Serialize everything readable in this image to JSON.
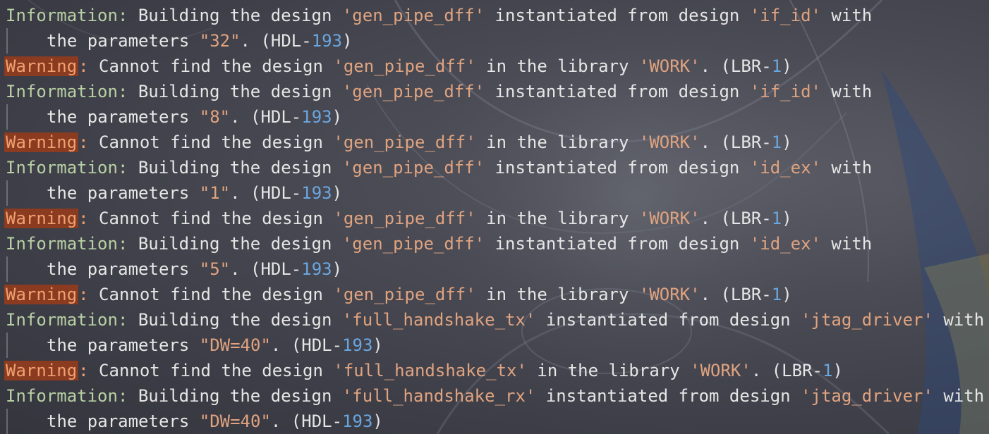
{
  "log": [
    {
      "kind": "info",
      "level": "Information",
      "segments": [
        {
          "t": "p",
          "v": " Building the design "
        },
        {
          "t": "s",
          "v": "'gen_pipe_dff'"
        },
        {
          "t": "p",
          "v": " instantiated from design "
        },
        {
          "t": "s",
          "v": "'if_id'"
        },
        {
          "t": "p",
          "v": " with"
        }
      ]
    },
    {
      "kind": "cont",
      "segments": [
        {
          "t": "p",
          "v": "the parameters "
        },
        {
          "t": "s",
          "v": "\"32\""
        },
        {
          "t": "p",
          "v": ". (HDL-"
        },
        {
          "t": "n",
          "v": "193"
        },
        {
          "t": "p",
          "v": ")"
        }
      ]
    },
    {
      "kind": "warn",
      "level": "Warning",
      "segments": [
        {
          "t": "p",
          "v": " Cannot find the design "
        },
        {
          "t": "s",
          "v": "'gen_pipe_dff'"
        },
        {
          "t": "p",
          "v": " in the library "
        },
        {
          "t": "s",
          "v": "'WORK'"
        },
        {
          "t": "p",
          "v": ". (LBR-"
        },
        {
          "t": "n",
          "v": "1"
        },
        {
          "t": "p",
          "v": ")"
        }
      ]
    },
    {
      "kind": "info",
      "level": "Information",
      "segments": [
        {
          "t": "p",
          "v": " Building the design "
        },
        {
          "t": "s",
          "v": "'gen_pipe_dff'"
        },
        {
          "t": "p",
          "v": " instantiated from design "
        },
        {
          "t": "s",
          "v": "'if_id'"
        },
        {
          "t": "p",
          "v": " with"
        }
      ]
    },
    {
      "kind": "cont",
      "segments": [
        {
          "t": "p",
          "v": "the parameters "
        },
        {
          "t": "s",
          "v": "\"8\""
        },
        {
          "t": "p",
          "v": ". (HDL-"
        },
        {
          "t": "n",
          "v": "193"
        },
        {
          "t": "p",
          "v": ")"
        }
      ]
    },
    {
      "kind": "warn",
      "level": "Warning",
      "segments": [
        {
          "t": "p",
          "v": " Cannot find the design "
        },
        {
          "t": "s",
          "v": "'gen_pipe_dff'"
        },
        {
          "t": "p",
          "v": " in the library "
        },
        {
          "t": "s",
          "v": "'WORK'"
        },
        {
          "t": "p",
          "v": ". (LBR-"
        },
        {
          "t": "n",
          "v": "1"
        },
        {
          "t": "p",
          "v": ")"
        }
      ]
    },
    {
      "kind": "info",
      "level": "Information",
      "segments": [
        {
          "t": "p",
          "v": " Building the design "
        },
        {
          "t": "s",
          "v": "'gen_pipe_dff'"
        },
        {
          "t": "p",
          "v": " instantiated from design "
        },
        {
          "t": "s",
          "v": "'id_ex'"
        },
        {
          "t": "p",
          "v": " with"
        }
      ]
    },
    {
      "kind": "cont",
      "segments": [
        {
          "t": "p",
          "v": "the parameters "
        },
        {
          "t": "s",
          "v": "\"1\""
        },
        {
          "t": "p",
          "v": ". (HDL-"
        },
        {
          "t": "n",
          "v": "193"
        },
        {
          "t": "p",
          "v": ")"
        }
      ]
    },
    {
      "kind": "warn",
      "level": "Warning",
      "segments": [
        {
          "t": "p",
          "v": " Cannot find the design "
        },
        {
          "t": "s",
          "v": "'gen_pipe_dff'"
        },
        {
          "t": "p",
          "v": " in the library "
        },
        {
          "t": "s",
          "v": "'WORK'"
        },
        {
          "t": "p",
          "v": ". (LBR-"
        },
        {
          "t": "n",
          "v": "1"
        },
        {
          "t": "p",
          "v": ")"
        }
      ]
    },
    {
      "kind": "info",
      "level": "Information",
      "segments": [
        {
          "t": "p",
          "v": " Building the design "
        },
        {
          "t": "s",
          "v": "'gen_pipe_dff'"
        },
        {
          "t": "p",
          "v": " instantiated from design "
        },
        {
          "t": "s",
          "v": "'id_ex'"
        },
        {
          "t": "p",
          "v": " with"
        }
      ]
    },
    {
      "kind": "cont",
      "segments": [
        {
          "t": "p",
          "v": "the parameters "
        },
        {
          "t": "s",
          "v": "\"5\""
        },
        {
          "t": "p",
          "v": ". (HDL-"
        },
        {
          "t": "n",
          "v": "193"
        },
        {
          "t": "p",
          "v": ")"
        }
      ]
    },
    {
      "kind": "warn",
      "level": "Warning",
      "segments": [
        {
          "t": "p",
          "v": " Cannot find the design "
        },
        {
          "t": "s",
          "v": "'gen_pipe_dff'"
        },
        {
          "t": "p",
          "v": " in the library "
        },
        {
          "t": "s",
          "v": "'WORK'"
        },
        {
          "t": "p",
          "v": ". (LBR-"
        },
        {
          "t": "n",
          "v": "1"
        },
        {
          "t": "p",
          "v": ")"
        }
      ]
    },
    {
      "kind": "info",
      "level": "Information",
      "segments": [
        {
          "t": "p",
          "v": " Building the design "
        },
        {
          "t": "s",
          "v": "'full_handshake_tx'"
        },
        {
          "t": "p",
          "v": " instantiated from design "
        },
        {
          "t": "s",
          "v": "'jtag_driver'"
        },
        {
          "t": "p",
          "v": " with"
        }
      ]
    },
    {
      "kind": "cont",
      "segments": [
        {
          "t": "p",
          "v": "the parameters "
        },
        {
          "t": "s",
          "v": "\"DW=40\""
        },
        {
          "t": "p",
          "v": ". (HDL-"
        },
        {
          "t": "n",
          "v": "193"
        },
        {
          "t": "p",
          "v": ")"
        }
      ]
    },
    {
      "kind": "warn",
      "level": "Warning",
      "segments": [
        {
          "t": "p",
          "v": " Cannot find the design "
        },
        {
          "t": "s",
          "v": "'full_handshake_tx'"
        },
        {
          "t": "p",
          "v": " in the library "
        },
        {
          "t": "s",
          "v": "'WORK'"
        },
        {
          "t": "p",
          "v": ". (LBR-"
        },
        {
          "t": "n",
          "v": "1"
        },
        {
          "t": "p",
          "v": ")"
        }
      ]
    },
    {
      "kind": "info",
      "level": "Information",
      "segments": [
        {
          "t": "p",
          "v": " Building the design "
        },
        {
          "t": "s",
          "v": "'full_handshake_rx'"
        },
        {
          "t": "p",
          "v": " instantiated from design "
        },
        {
          "t": "s",
          "v": "'jtag_driver'"
        },
        {
          "t": "p",
          "v": " with"
        }
      ]
    },
    {
      "kind": "cont",
      "segments": [
        {
          "t": "p",
          "v": "the parameters "
        },
        {
          "t": "s",
          "v": "\"DW=40\""
        },
        {
          "t": "p",
          "v": ". (HDL-"
        },
        {
          "t": "n",
          "v": "193"
        },
        {
          "t": "p",
          "v": ")"
        }
      ]
    }
  ],
  "colors": {
    "info_label": "#b8d0a4",
    "warn_label": "#f0a070",
    "warn_highlight": "#8a3b20",
    "string": "#e0a380",
    "number": "#6aa6e0",
    "text": "#e6e6e6"
  }
}
